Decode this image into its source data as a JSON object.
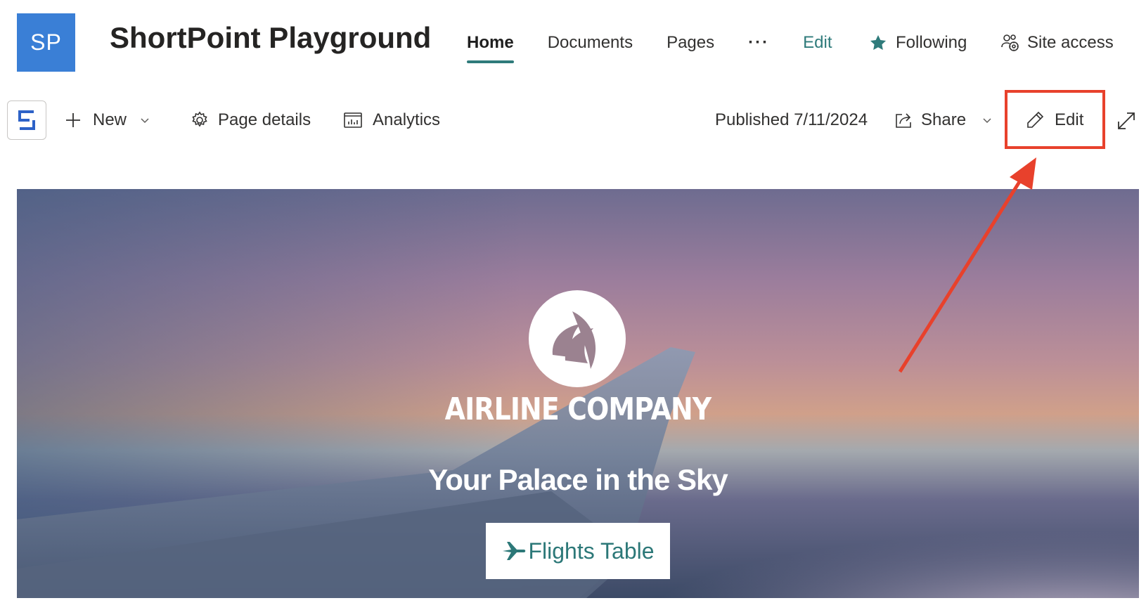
{
  "site": {
    "logo_text": "SP",
    "logo_color": "#3a7fd6",
    "title": "ShortPoint Playground"
  },
  "top_nav": {
    "items": [
      {
        "label": "Home",
        "active": true
      },
      {
        "label": "Documents"
      },
      {
        "label": "Pages"
      },
      {
        "label": "···"
      },
      {
        "label": "Edit"
      }
    ],
    "following_label": "Following",
    "site_access_label": "Site access",
    "accent_color": "#2f7b7b"
  },
  "command_bar": {
    "app_icon": "shortpoint-icon",
    "new_label": "New",
    "page_details_label": "Page details",
    "analytics_label": "Analytics",
    "published_text": "Published 7/11/2024",
    "share_label": "Share",
    "edit_label": "Edit",
    "expand_icon": "expand-icon"
  },
  "annotation": {
    "highlight_color": "#e8412c",
    "target": "Edit"
  },
  "hero": {
    "brand_name": "AIRLINE COMPANY",
    "tagline": "Your Palace in the Sky",
    "button_label": "Flights Table",
    "button_icon": "airplane-icon",
    "button_text_color": "#2c7878"
  }
}
